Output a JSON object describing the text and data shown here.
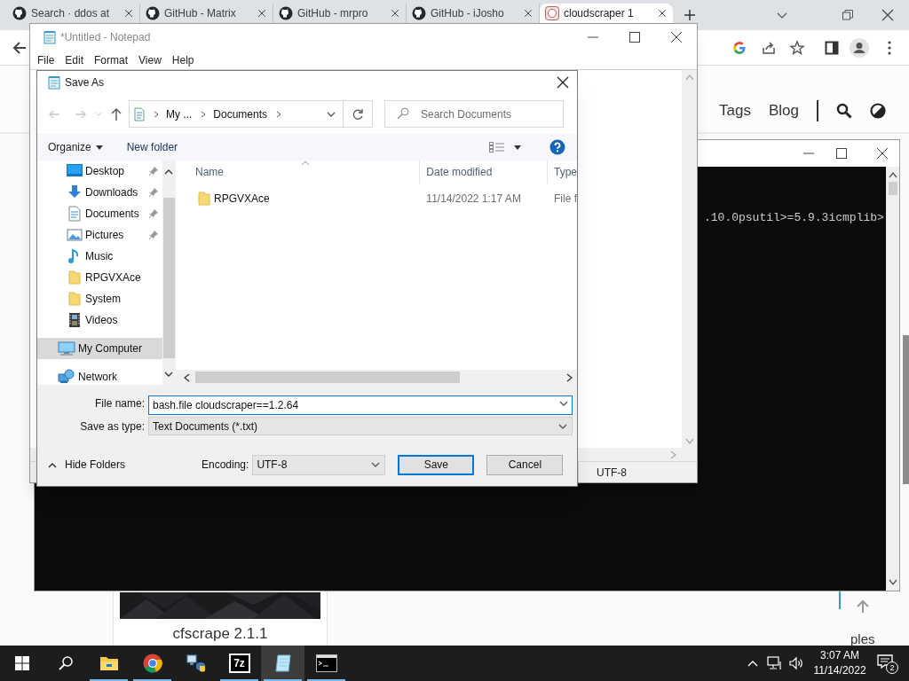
{
  "browser": {
    "tabs": [
      {
        "label": "Search · ddos at",
        "kind": "github",
        "selected": false
      },
      {
        "label": "GitHub - Matrix",
        "kind": "github",
        "selected": false
      },
      {
        "label": "GitHub - mrpro",
        "kind": "github",
        "selected": false
      },
      {
        "label": "GitHub - iJosho",
        "kind": "github",
        "selected": false
      },
      {
        "label": "cloudscraper 1",
        "kind": "site",
        "selected": true
      }
    ],
    "nav_links": [
      "Tags",
      "Blog"
    ],
    "card_title": "cfscrape 2.1.1",
    "side_text": "ples"
  },
  "console": {
    "line": ".10.0psutil>=5.9.3icmplib>"
  },
  "notepad": {
    "title": "*Untitled - Notepad",
    "menu": [
      "File",
      "Edit",
      "Format",
      "View",
      "Help"
    ],
    "encoding": "UTF-8"
  },
  "save_as": {
    "title": "Save As",
    "breadcrumb": [
      "My ...",
      "Documents"
    ],
    "search_placeholder": "Search Documents",
    "organize": "Organize",
    "new_folder": "New folder",
    "nav_pane": {
      "pinned_group": [
        {
          "label": "Desktop",
          "kind": "desktop",
          "pinned": true,
          "selected": false
        },
        {
          "label": "Downloads",
          "kind": "downloads",
          "pinned": true,
          "selected": false
        },
        {
          "label": "Documents",
          "kind": "documents",
          "pinned": true,
          "selected": false
        },
        {
          "label": "Pictures",
          "kind": "pictures",
          "pinned": true,
          "selected": false
        },
        {
          "label": "Music",
          "kind": "music",
          "pinned": false,
          "selected": false
        },
        {
          "label": "RPGVXAce",
          "kind": "folder",
          "pinned": false,
          "selected": false
        },
        {
          "label": "System",
          "kind": "folder",
          "pinned": false,
          "selected": false
        },
        {
          "label": "Videos",
          "kind": "videos",
          "pinned": false,
          "selected": false
        }
      ],
      "roots": [
        {
          "label": "My Computer",
          "kind": "computer",
          "selected": true
        },
        {
          "label": "Network",
          "kind": "network",
          "selected": false
        }
      ]
    },
    "columns": [
      "Name",
      "Date modified",
      "Type"
    ],
    "rows": [
      {
        "name": "RPGVXAce",
        "date_modified": "11/14/2022 1:17 AM",
        "type": "File f",
        "selected": false
      }
    ],
    "file_name": {
      "label": "File name:",
      "value": "bash.file cloudscraper==1.2.64"
    },
    "save_as_type": {
      "label": "Save as type:",
      "value": "Text Documents (*.txt)"
    },
    "hide_folders": "Hide Folders",
    "encoding": {
      "label": "Encoding:",
      "value": "UTF-8"
    },
    "buttons": [
      "Save",
      "Cancel"
    ]
  },
  "taskbar": {
    "apps": [
      {
        "kind": "explorer",
        "running": true,
        "active": false
      },
      {
        "kind": "chrome",
        "running": true,
        "active": false
      },
      {
        "kind": "python",
        "running": false,
        "active": false
      },
      {
        "kind": "sevenzip",
        "label": "7z",
        "running": true,
        "active": false
      },
      {
        "kind": "notepad",
        "running": true,
        "active": true
      },
      {
        "kind": "console",
        "running": true,
        "active": false
      }
    ],
    "time": "3:07 AM",
    "date": "11/14/2022",
    "notifications": "2"
  }
}
